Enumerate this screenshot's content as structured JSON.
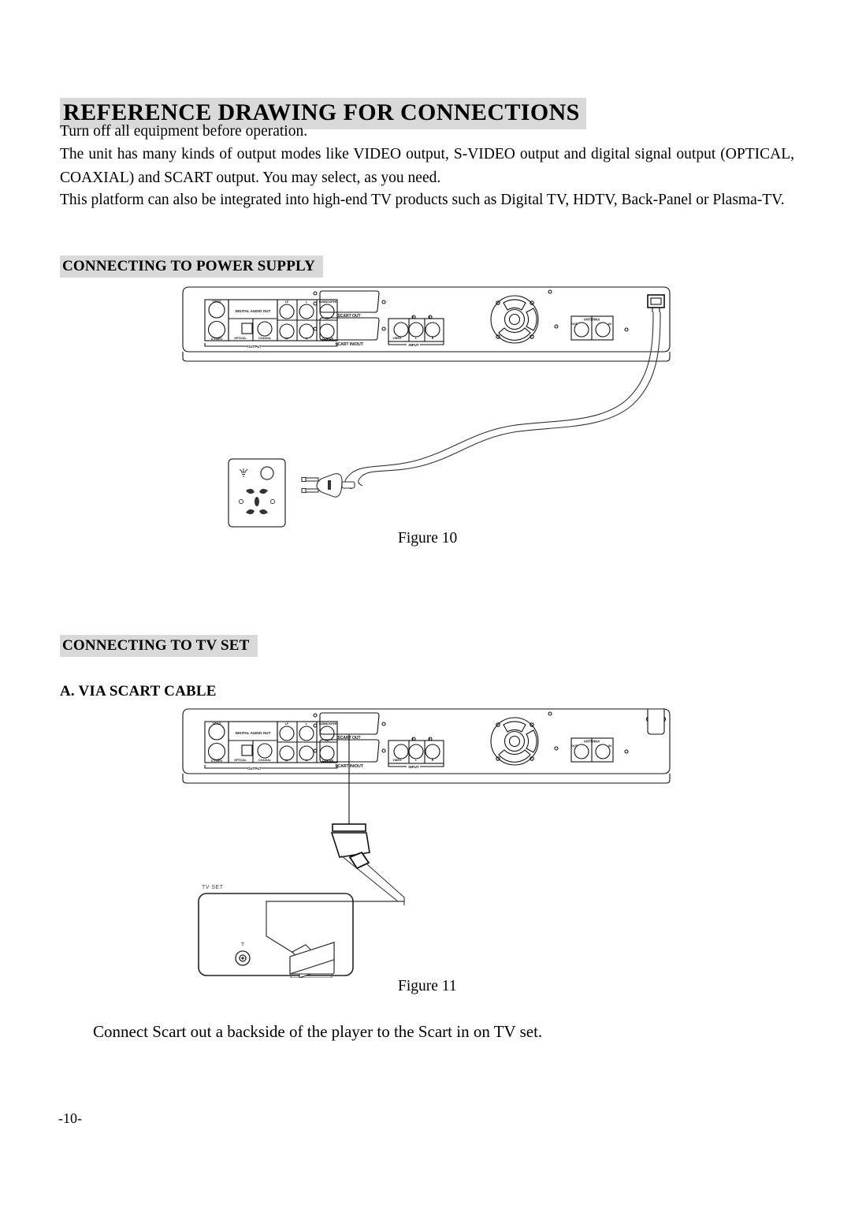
{
  "document": {
    "title": "REFERENCE DRAWING FOR CONNECTIONS",
    "page_number": "-10-"
  },
  "intro": {
    "line1": "Turn off all equipment before operation.",
    "line2": "The unit has many kinds of output modes like VIDEO output, S-VIDEO output and digital signal output (OPTICAL, COAXIAL) and SCART output. You may select, as you need.",
    "line3": "This platform can also be integrated into high-end TV products such as Digital TV, HDTV, Back-Panel or Plasma-TV."
  },
  "sections": {
    "power": {
      "heading": "CONNECTING TO POWER SUPPLY",
      "figure_caption": "Figure 10"
    },
    "tvset": {
      "heading": "CONNECTING TO TV SET",
      "subheading": "A. VIA SCART CABLE",
      "figure_caption": "Figure 11",
      "instruction": "Connect Scart out a backside of the player to the Scart in on TV set."
    }
  },
  "rear_panel_labels": {
    "video": "VIDEO",
    "s_video": "S-VIDEO",
    "digital_audio_out": "DIGITAL AUDIO OUT",
    "optical": "OPTICAL",
    "coaxial": "COAXIAL",
    "output": "OUTPUT",
    "lf": "LF",
    "rf": "RF",
    "l": "L",
    "r": "R",
    "subwoofer": "SUBWOOFER",
    "center": "CENTER",
    "scart_out": "SCART OUT",
    "scart_in_out": "SCART IN/OUT",
    "input_video": "VIDEO",
    "input_l": "L",
    "input_r": "R",
    "input": "INPUT",
    "antenna": "ANTENNA",
    "antenna_out": "OUT",
    "antenna_in": "IN"
  },
  "tv_set": {
    "label": "TV SET",
    "antenna_mark": "T"
  },
  "colors": {
    "highlight": "#d9d9d9",
    "ink": "#000000",
    "line_gray": "#555555",
    "light_gray": "#888888"
  }
}
